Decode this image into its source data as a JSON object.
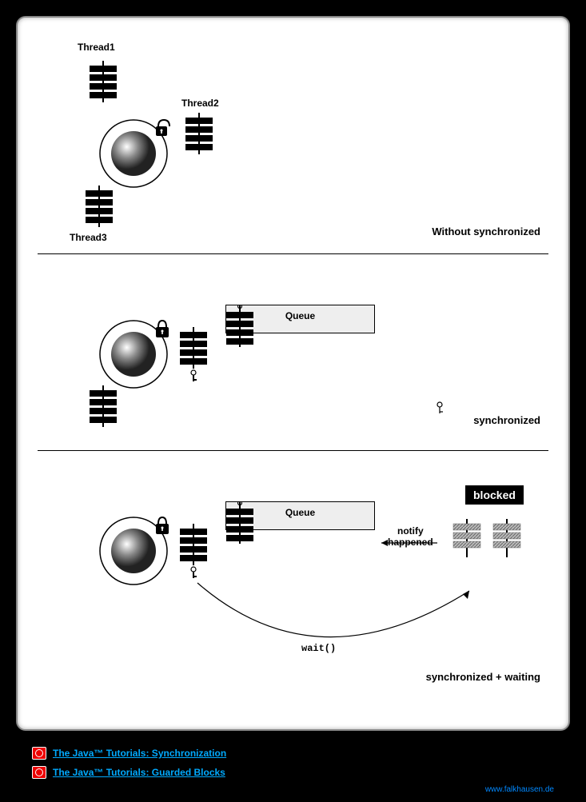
{
  "section1": {
    "t1": "Thread1",
    "t2": "Thread2",
    "t3": "Thread3",
    "caption": "Without synchronized"
  },
  "section2": {
    "queue": "Queue",
    "caption": "synchronized"
  },
  "section3": {
    "queue": "Queue",
    "blocked": "blocked",
    "notify": "notify\nhappened",
    "wait": "wait()",
    "caption": "synchronized + waiting"
  },
  "links": {
    "l1": "The Java™ Tutorials: Synchronization",
    "l2": "The Java™ Tutorials: Guarded Blocks"
  },
  "credit": "www.falkhausen.de"
}
